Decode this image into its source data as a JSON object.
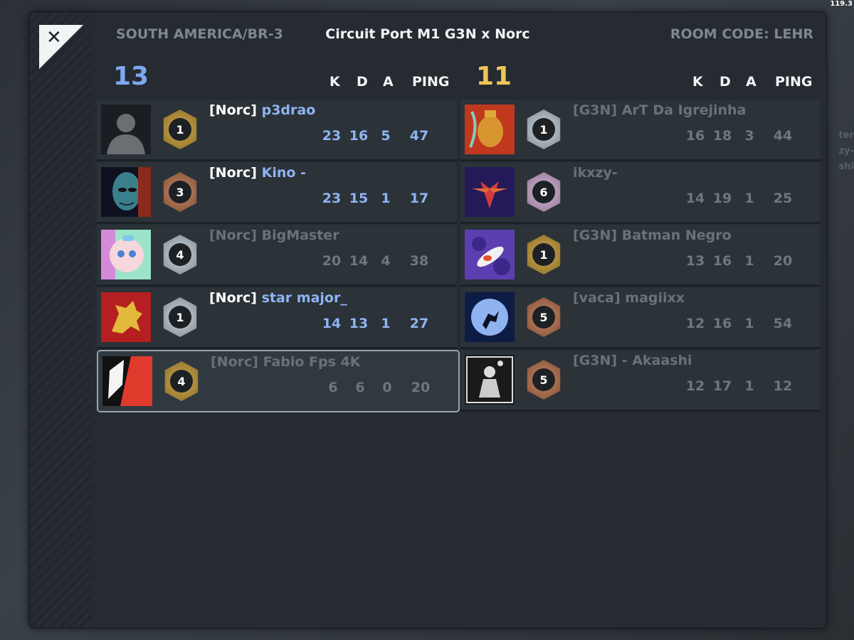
{
  "fps": "119.3",
  "header": {
    "region": "SOUTH AMERICA/BR-3",
    "match": "Circuit Port M1 G3N x Norc",
    "room_code": "ROOM CODE: LEHR",
    "close_label": "✕"
  },
  "background_text": [
    "ter",
    "zy-",
    "shi"
  ],
  "columns": {
    "k": "K",
    "d": "D",
    "a": "A",
    "ping": "PING"
  },
  "teams": [
    {
      "score": "13",
      "color": "#7ea8ef",
      "players": [
        {
          "tag": "[Norc]",
          "name": "p3drao",
          "rank": "1",
          "badge": "gold",
          "k": "23",
          "d": "16",
          "a": "5",
          "ping": "47",
          "active": true,
          "avatar": "default-avatar"
        },
        {
          "tag": "[Norc]",
          "name": "Kino -",
          "rank": "3",
          "badge": "bronze",
          "k": "23",
          "d": "15",
          "a": "1",
          "ping": "17",
          "active": true,
          "avatar": "alien-face-avatar"
        },
        {
          "tag": "[Norc]",
          "name": "BigMaster",
          "rank": "4",
          "badge": "silver",
          "k": "20",
          "d": "14",
          "a": "4",
          "ping": "38",
          "active": false,
          "avatar": "anime-girl-avatar"
        },
        {
          "tag": "[Norc]",
          "name": "star major_",
          "rank": "1",
          "badge": "silver",
          "k": "14",
          "d": "13",
          "a": "1",
          "ping": "27",
          "active": true,
          "avatar": "golden-lion-avatar"
        },
        {
          "tag": "[Norc]",
          "name": "Fabio Fps 4K",
          "rank": "4",
          "badge": "gold",
          "k": "6",
          "d": "6",
          "a": "0",
          "ping": "20",
          "active": false,
          "selected": true,
          "avatar": "abstract-red-avatar"
        }
      ]
    },
    {
      "score": "11",
      "color": "#f0c45a",
      "players": [
        {
          "tag": "[G3N]",
          "name": "ArT Da Igrejinha",
          "rank": "1",
          "badge": "silver",
          "k": "16",
          "d": "18",
          "a": "3",
          "ping": "44",
          "active": false,
          "avatar": "dragon-vase-avatar"
        },
        {
          "tag": "",
          "name": "ikxzy-",
          "rank": "6",
          "badge": "lilac",
          "k": "14",
          "d": "19",
          "a": "1",
          "ping": "25",
          "active": false,
          "avatar": "phoenix-avatar"
        },
        {
          "tag": "[G3N]",
          "name": "Batman Negro",
          "rank": "1",
          "badge": "gold",
          "k": "13",
          "d": "16",
          "a": "1",
          "ping": "20",
          "active": false,
          "avatar": "koi-fish-avatar"
        },
        {
          "tag": "[vaca]",
          "name": "magiixx",
          "rank": "5",
          "badge": "bronze",
          "k": "12",
          "d": "16",
          "a": "1",
          "ping": "54",
          "active": false,
          "avatar": "moon-jumper-avatar"
        },
        {
          "tag": "[G3N]",
          "name": "- Akaashi",
          "rank": "5",
          "badge": "bronze",
          "k": "12",
          "d": "17",
          "a": "1",
          "ping": "12",
          "active": false,
          "avatar": "warrior-art-avatar"
        }
      ]
    }
  ]
}
